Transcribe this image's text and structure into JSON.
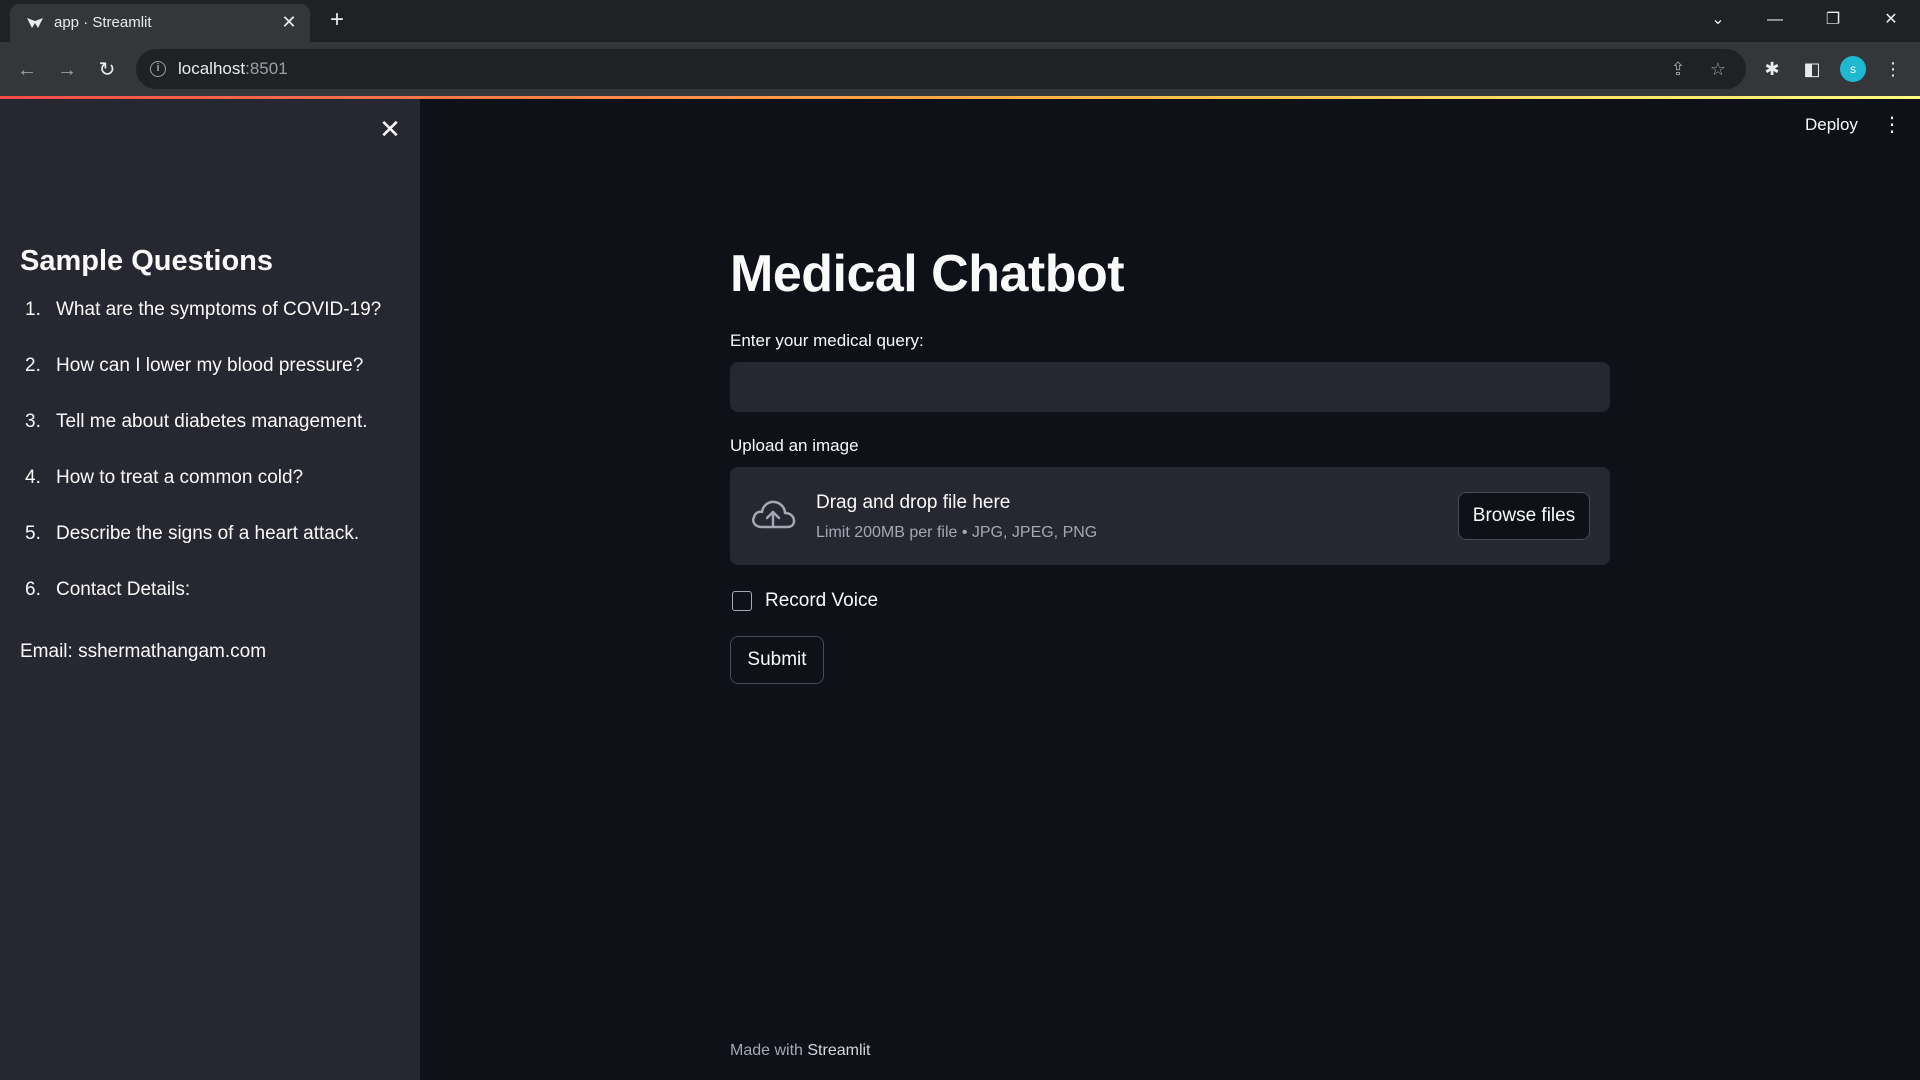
{
  "browser": {
    "tab_title": "app · Streamlit",
    "url_host": "localhost",
    "url_port": ":8501",
    "avatar_letter": "s"
  },
  "app": {
    "deploy_label": "Deploy",
    "sidebar": {
      "title": "Sample Questions",
      "questions": [
        {
          "num": "1.",
          "text": "What are the symptoms of COVID-19?"
        },
        {
          "num": "2.",
          "text": "How can I lower my blood pressure?"
        },
        {
          "num": "3.",
          "text": "Tell me about diabetes management."
        },
        {
          "num": "4.",
          "text": "How to treat a common cold?"
        },
        {
          "num": "5.",
          "text": "Describe the signs of a heart attack."
        },
        {
          "num": "6.",
          "text": "Contact Details:"
        }
      ],
      "email": "Email: sshermathangam.com"
    },
    "main": {
      "title": "Medical Chatbot",
      "query_label": "Enter your medical query:",
      "query_value": "",
      "upload_label": "Upload an image",
      "drop_text": "Drag and drop file here",
      "limit_text": "Limit 200MB per file • JPG, JPEG, PNG",
      "browse_label": "Browse files",
      "record_voice_label": "Record Voice",
      "record_voice_checked": false,
      "submit_label": "Submit",
      "footer_prefix": "Made with",
      "footer_brand": "Streamlit"
    }
  },
  "colors": {
    "background": "#0e1117",
    "sidebar": "#262730",
    "accent": "#ff4b4b"
  }
}
